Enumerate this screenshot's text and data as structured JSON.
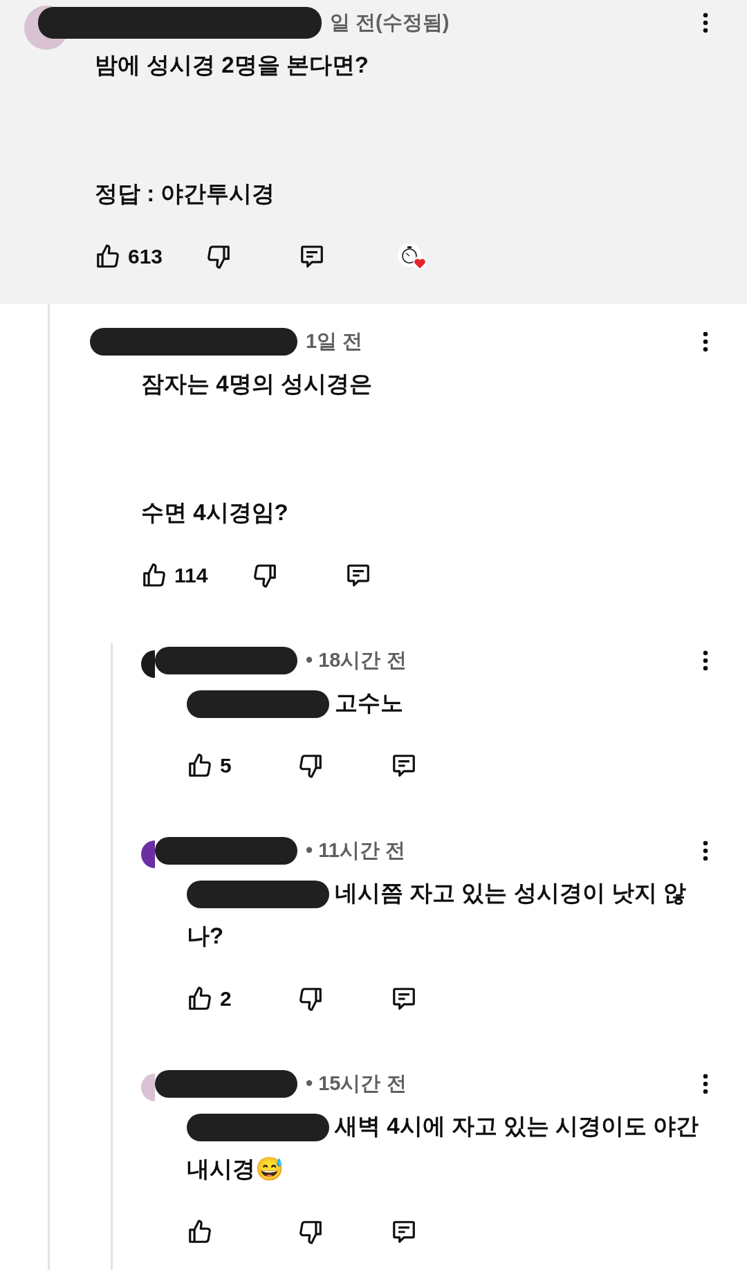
{
  "comment": {
    "avatar": true,
    "meta": "일 전(수정됨)",
    "text": "밤에 성시경 2명을 본다면?\n\n\n정답 : 야간투시경",
    "likes": "613",
    "creator_heart": true,
    "highlighted": true,
    "replies": [
      {
        "meta": "1일 전",
        "text": "잠자는 4명의 성시경은\n\n\n수면 4시경임?",
        "likes": "114",
        "creator_heart": false,
        "highlighted": false,
        "replies": [
          {
            "avatar": true,
            "meta": "• 18시간 전",
            "mention": true,
            "text": "고수노",
            "likes": "5",
            "creator_heart": false,
            "highlighted": false
          },
          {
            "avatar": true,
            "meta": "• 11시간 전",
            "mention": true,
            "text": "네시쯤 자고 있는 성시경이 낫지 않나?",
            "likes": "2",
            "creator_heart": false,
            "highlighted": false
          },
          {
            "avatar": true,
            "meta": "• 15시간 전",
            "mention": true,
            "text": "새벽 4시에 자고 있는 시경이도 야간내시경😅",
            "creator_heart": false,
            "highlighted": false
          }
        ]
      }
    ]
  }
}
